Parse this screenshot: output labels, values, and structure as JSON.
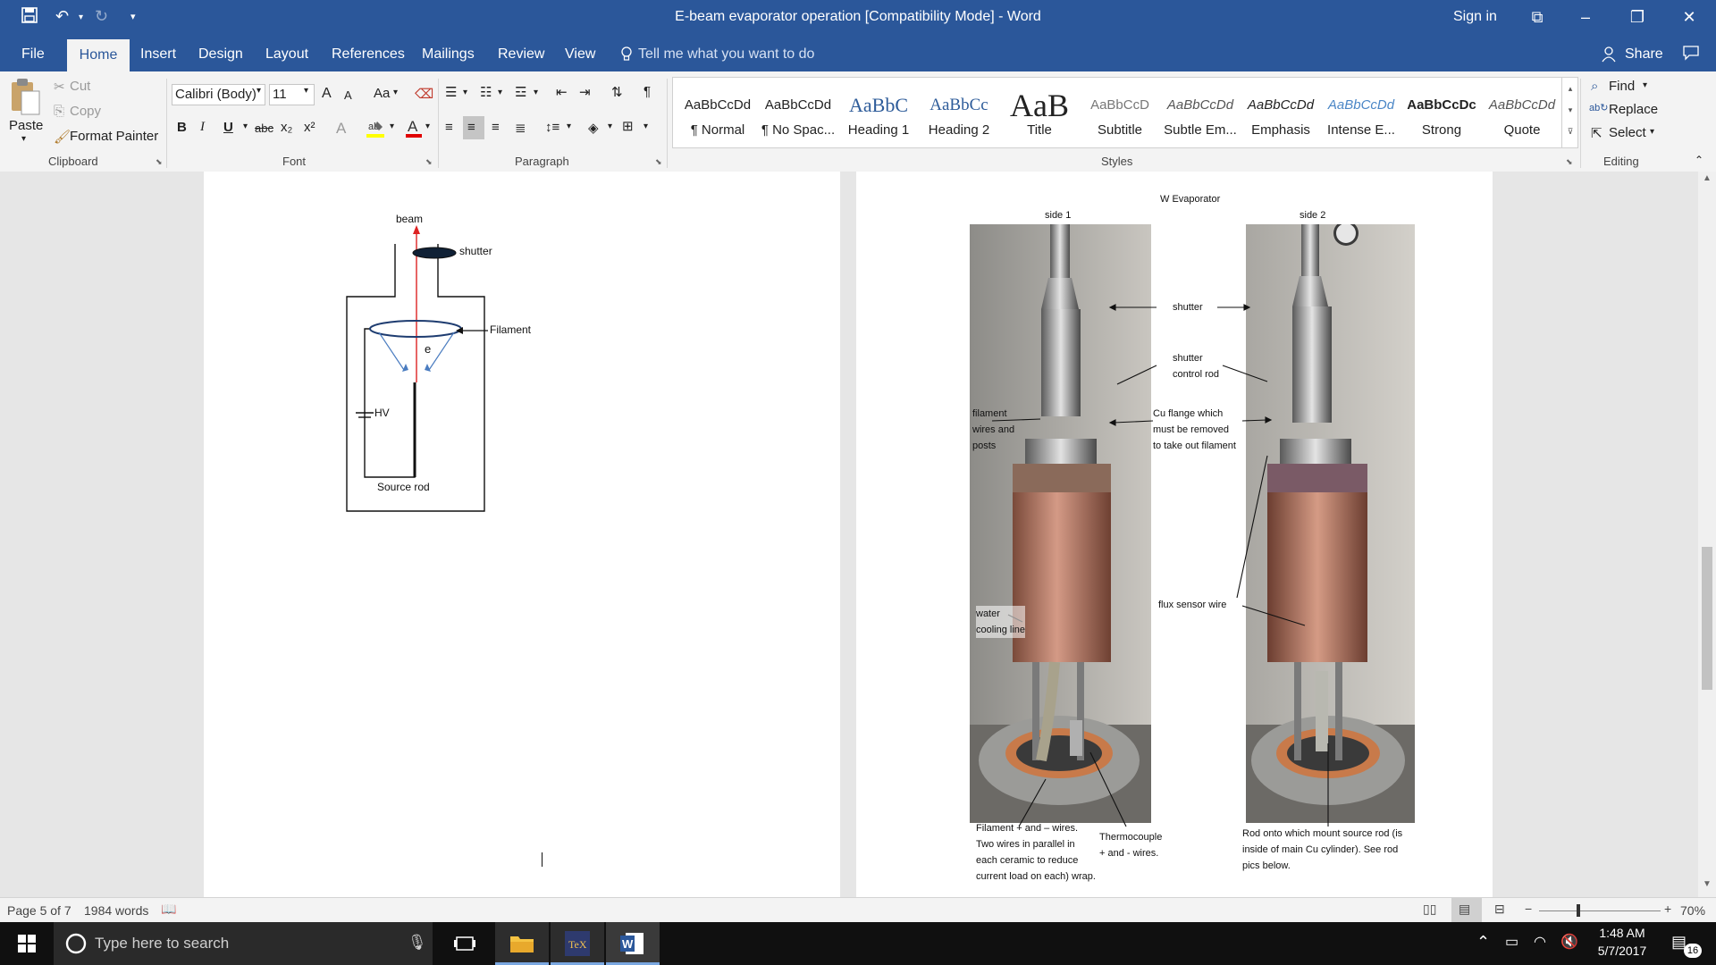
{
  "window": {
    "title": "E-beam evaporator operation [Compatibility Mode]  -  Word",
    "sign_in": "Sign in"
  },
  "tabs": {
    "file": "File",
    "home": "Home",
    "insert": "Insert",
    "design": "Design",
    "layout": "Layout",
    "references": "References",
    "mailings": "Mailings",
    "review": "Review",
    "view": "View",
    "tell_me": "Tell me what you want to do",
    "share": "Share"
  },
  "clipboard": {
    "paste": "Paste",
    "cut": "Cut",
    "copy": "Copy",
    "format_painter": "Format Painter",
    "label": "Clipboard"
  },
  "font": {
    "name": "Calibri (Body)",
    "size": "11",
    "case": "Aa",
    "label": "Font",
    "bold": "B",
    "italic": "I",
    "underline": "U",
    "strike": "abc",
    "sub": "x₂",
    "sup": "x²",
    "grow": "A",
    "shrink": "A",
    "highlight_color": "#ffff00",
    "font_color": "#e00000"
  },
  "paragraph": {
    "label": "Paragraph",
    "pilcrow": "¶"
  },
  "styles": {
    "label": "Styles",
    "items": [
      {
        "preview": "AaBbCcDd",
        "name": "¶ Normal"
      },
      {
        "preview": "AaBbCcDd",
        "name": "¶ No Spac..."
      },
      {
        "preview": "AaBbC",
        "name": "Heading 1"
      },
      {
        "preview": "AaBbCc",
        "name": "Heading 2"
      },
      {
        "preview": "AaB",
        "name": "Title"
      },
      {
        "preview": "AaBbCcD",
        "name": "Subtitle"
      },
      {
        "preview": "AaBbCcDd",
        "name": "Subtle Em..."
      },
      {
        "preview": "AaBbCcDd",
        "name": "Emphasis"
      },
      {
        "preview": "AaBbCcDd",
        "name": "Intense E..."
      },
      {
        "preview": "AaBbCcDc",
        "name": "Strong"
      },
      {
        "preview": "AaBbCcDd",
        "name": "Quote"
      }
    ]
  },
  "editing": {
    "find": "Find",
    "replace": "Replace",
    "select": "Select",
    "label": "Editing"
  },
  "diagram": {
    "beam": "beam",
    "shutter": "shutter",
    "filament": "Filament",
    "e": "e",
    "hv": "HV",
    "source_rod": "Source rod"
  },
  "photos": {
    "header": "W Evaporator",
    "side1": "side 1",
    "side2": "side 2",
    "shutter": "shutter",
    "shutter_control_1": "shutter",
    "shutter_control_2": "control rod",
    "filament_wires_1": "filament",
    "filament_wires_2": "wires and",
    "filament_wires_3": "posts",
    "cu_flange_1": "Cu flange which",
    "cu_flange_2": "must be removed",
    "cu_flange_3": "to take out filament",
    "flux_sensor": "flux sensor wire",
    "water_1": "water",
    "water_2": "cooling line",
    "fil_wires_1": "Filament + and – wires.",
    "fil_wires_2": "Two wires in parallel in",
    "fil_wires_3": "each ceramic to reduce",
    "fil_wires_4": "current load on each) wrap.",
    "thermo_1": "Thermocouple",
    "thermo_2": "+ and - wires.",
    "rod_1": "Rod onto which mount source rod (is",
    "rod_2": "inside of main Cu cylinder). See rod",
    "rod_3": "pics below."
  },
  "status": {
    "page": "Page 5 of 7",
    "words": "1984 words",
    "zoom": "70%"
  },
  "taskbar": {
    "search_placeholder": "Type here to search",
    "time": "1:48 AM",
    "date": "5/7/2017",
    "notifications": "16"
  }
}
